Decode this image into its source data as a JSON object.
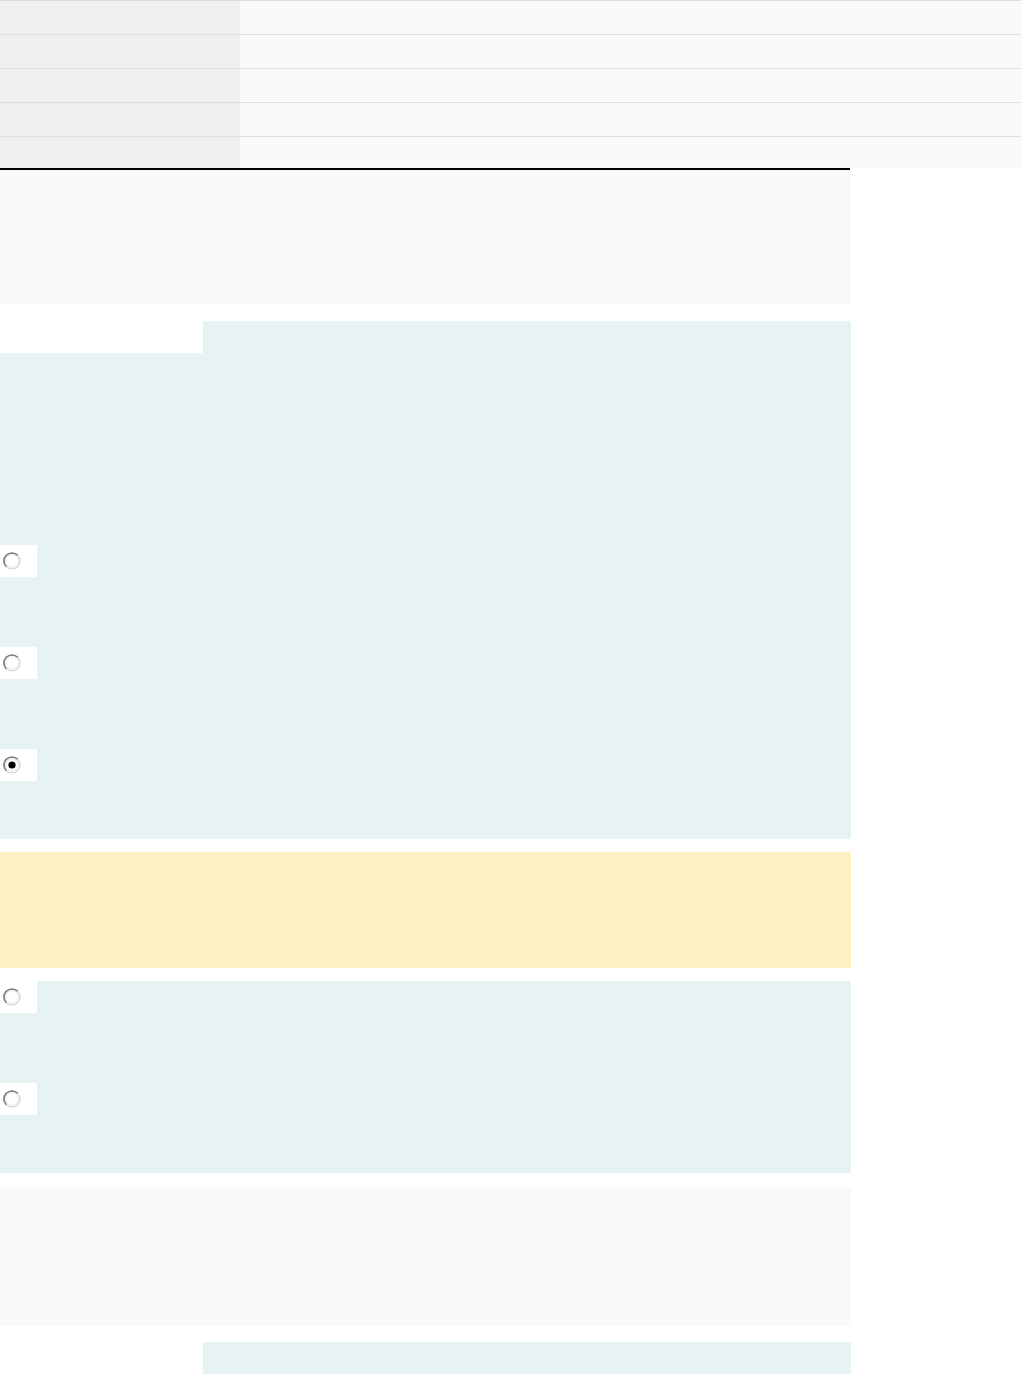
{
  "radio_groups": [
    {
      "options": [
        {
          "selected": false
        },
        {
          "selected": false
        },
        {
          "selected": true
        }
      ]
    },
    {
      "options": [
        {
          "selected": false
        },
        {
          "selected": false
        }
      ]
    }
  ]
}
